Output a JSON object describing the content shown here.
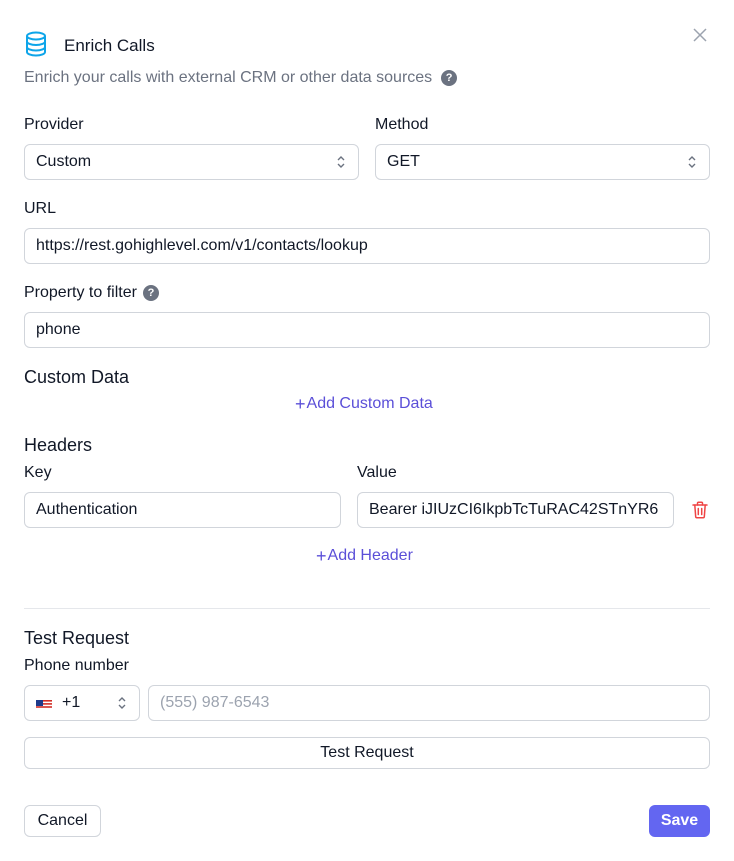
{
  "header": {
    "title": "Enrich Calls",
    "subtitle": "Enrich your calls with external CRM or other data sources",
    "help_glyph": "?",
    "icon": "database-icon",
    "close_icon": "close-icon"
  },
  "form": {
    "provider_label": "Provider",
    "provider_value": "Custom",
    "method_label": "Method",
    "method_value": "GET",
    "url_label": "URL",
    "url_value": "https://rest.gohighlevel.com/v1/contacts/lookup",
    "property_label": "Property to filter",
    "property_help": "?",
    "property_value": "phone"
  },
  "custom_data": {
    "title": "Custom Data",
    "add_plus": "+",
    "add_label": "Add Custom Data"
  },
  "headers": {
    "title": "Headers",
    "key_label": "Key",
    "value_label": "Value",
    "rows": [
      {
        "key": "Authentication",
        "value": "Bearer iJIUzCI6IkpbTcTuRAC42STnYR6"
      }
    ],
    "add_plus": "+",
    "add_label": "Add Header"
  },
  "test": {
    "title": "Test Request",
    "phone_label": "Phone number",
    "country_code": "+1",
    "phone_placeholder": "(555) 987-6543",
    "button_label": "Test Request"
  },
  "footer": {
    "cancel_label": "Cancel",
    "save_label": "Save"
  },
  "colors": {
    "accent": "#6366f1",
    "link": "#5b4fd8",
    "icon_blue": "#0ea5e9",
    "danger": "#ef4444"
  }
}
